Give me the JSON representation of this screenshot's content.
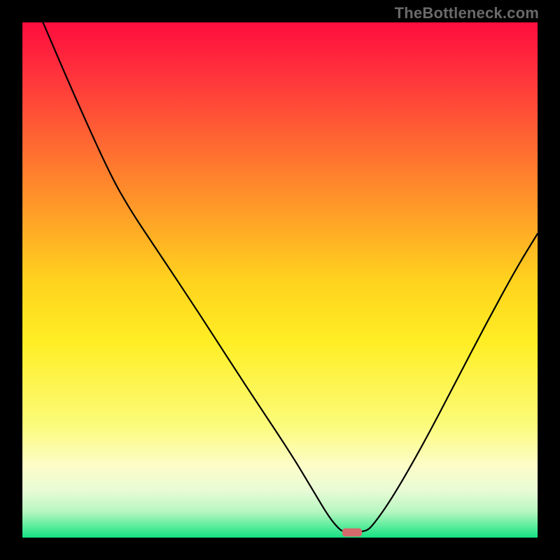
{
  "watermark": {
    "text": "TheBottleneck.com"
  },
  "chart_data": {
    "type": "line",
    "title": "",
    "xlabel": "",
    "ylabel": "",
    "xlim": [
      0,
      100
    ],
    "ylim": [
      0,
      100
    ],
    "grid": false,
    "legend": false,
    "gradient_stops": [
      {
        "offset": 0.0,
        "color": "#ff0d3e"
      },
      {
        "offset": 0.12,
        "color": "#ff3a3b"
      },
      {
        "offset": 0.32,
        "color": "#ff8a2b"
      },
      {
        "offset": 0.5,
        "color": "#ffd21e"
      },
      {
        "offset": 0.62,
        "color": "#ffee24"
      },
      {
        "offset": 0.78,
        "color": "#fbfb7a"
      },
      {
        "offset": 0.86,
        "color": "#fdfdc8"
      },
      {
        "offset": 0.91,
        "color": "#e7fbd6"
      },
      {
        "offset": 0.95,
        "color": "#b6f6c0"
      },
      {
        "offset": 0.975,
        "color": "#64eda0"
      },
      {
        "offset": 1.0,
        "color": "#15e183"
      }
    ],
    "curve_points": [
      {
        "x": 4.0,
        "y": 100.0
      },
      {
        "x": 10.0,
        "y": 86.0
      },
      {
        "x": 17.0,
        "y": 70.5
      },
      {
        "x": 21.0,
        "y": 63.5
      },
      {
        "x": 25.0,
        "y": 57.5
      },
      {
        "x": 34.0,
        "y": 44.0
      },
      {
        "x": 43.0,
        "y": 30.0
      },
      {
        "x": 52.0,
        "y": 16.5
      },
      {
        "x": 56.5,
        "y": 9.0
      },
      {
        "x": 59.5,
        "y": 4.0
      },
      {
        "x": 61.5,
        "y": 1.6
      },
      {
        "x": 62.5,
        "y": 1.1
      },
      {
        "x": 66.5,
        "y": 1.1
      },
      {
        "x": 68.0,
        "y": 2.3
      },
      {
        "x": 72.0,
        "y": 8.0
      },
      {
        "x": 78.0,
        "y": 18.5
      },
      {
        "x": 84.0,
        "y": 30.0
      },
      {
        "x": 90.0,
        "y": 41.5
      },
      {
        "x": 96.0,
        "y": 52.5
      },
      {
        "x": 100.0,
        "y": 59.0
      }
    ],
    "marker": {
      "x": 64.0,
      "y": 1.0,
      "w": 3.8,
      "h": 1.6,
      "color": "#d46a6a"
    }
  }
}
